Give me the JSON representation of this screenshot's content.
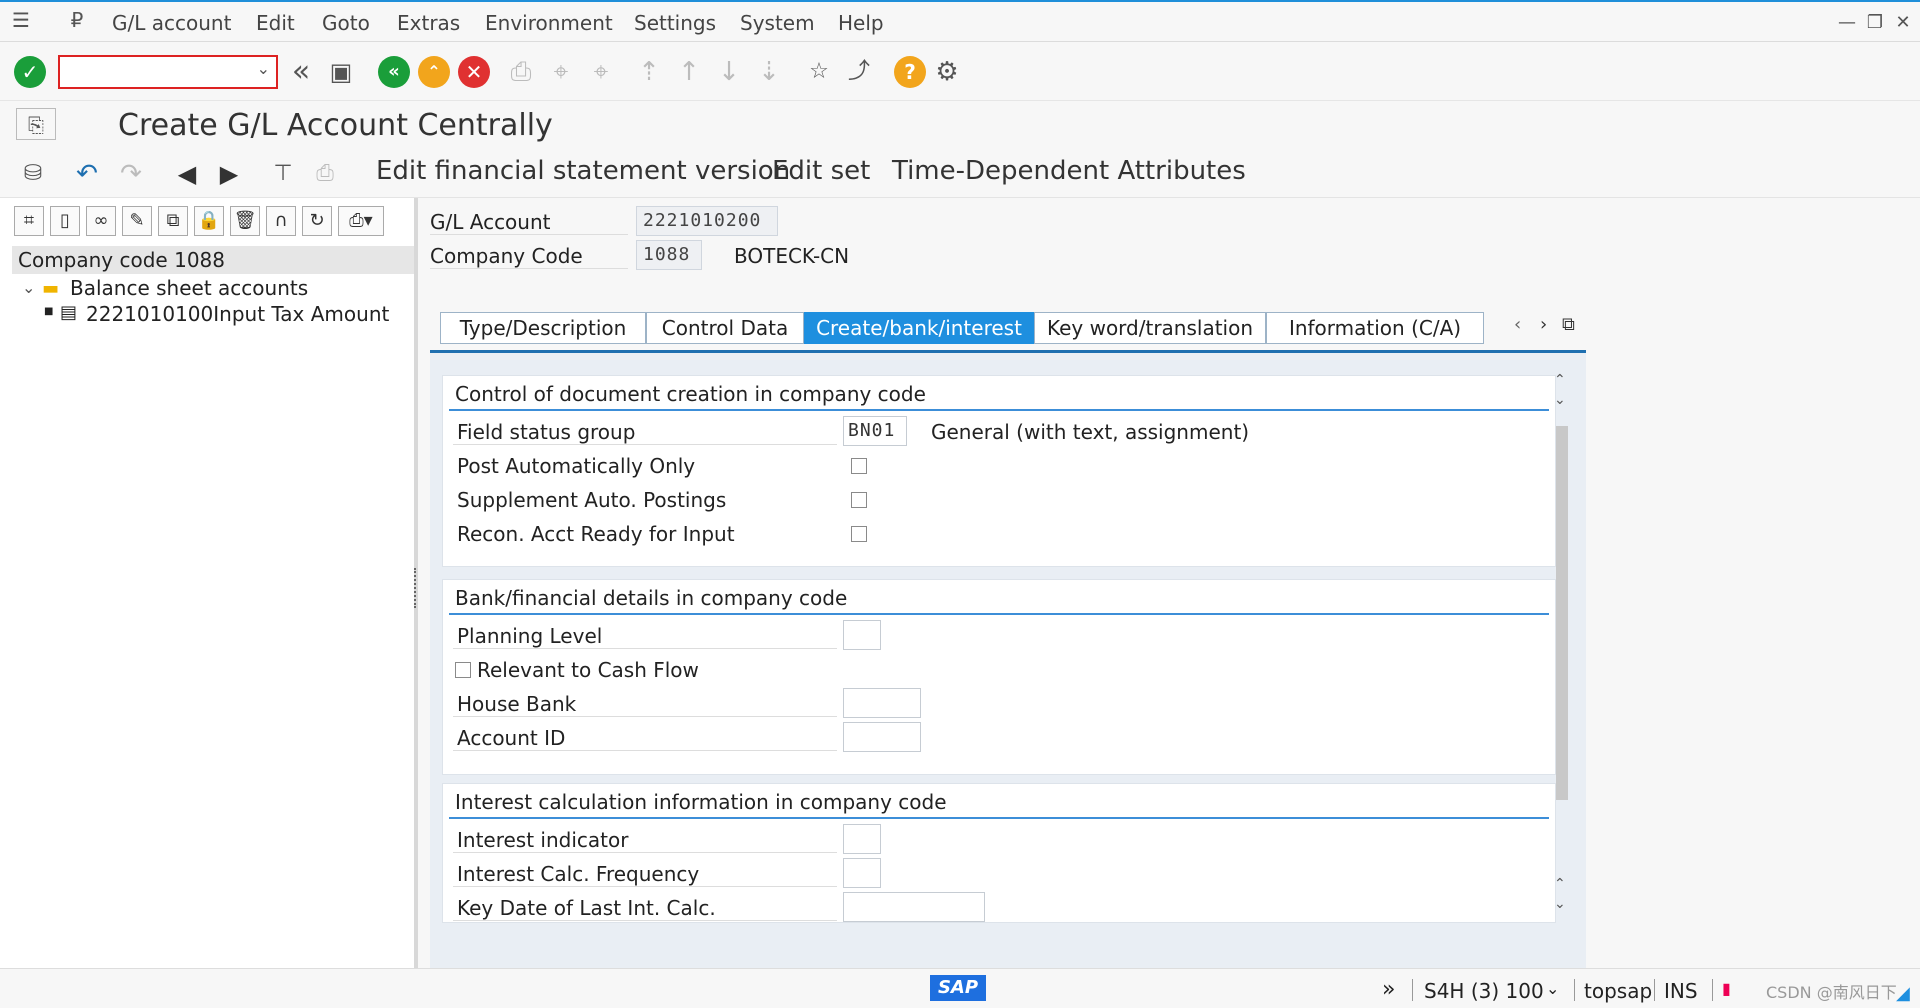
{
  "menubar": {
    "items": [
      "G/L account",
      "Edit",
      "Goto",
      "Extras",
      "Environment",
      "Settings",
      "System",
      "Help"
    ]
  },
  "toolbar": {
    "command_value": ""
  },
  "title": "Create G/L Account Centrally",
  "app_toolbar": {
    "buttons": [
      "Edit financial statement version",
      "Edit set",
      "Time-Dependent Attributes"
    ]
  },
  "tree": {
    "header": "Company code 1088",
    "folder": "Balance sheet accounts",
    "item": "2221010100Input Tax Amount"
  },
  "header": {
    "gl_account_label": "G/L Account",
    "gl_account_value": "2221010200",
    "company_code_label": "Company Code",
    "company_code_value": "1088",
    "company_name": "BOTECK-CN"
  },
  "tabs": [
    "Type/Description",
    "Control Data",
    "Create/bank/interest",
    "Key word/translation",
    "Information (C/A)"
  ],
  "active_tab": "Create/bank/interest",
  "groups": {
    "doc_creation": {
      "title": "Control of document creation in company code",
      "field_status_group_label": "Field status group",
      "field_status_group_value": "BN01",
      "field_status_group_text": "General (with text, assignment)",
      "post_auto_label": "Post Automatically Only",
      "supplement_auto_label": "Supplement Auto. Postings",
      "recon_ready_label": "Recon. Acct Ready for Input"
    },
    "bank": {
      "title": "Bank/financial details in company code",
      "planning_level_label": "Planning Level",
      "cash_flow_label": "Relevant to Cash Flow",
      "house_bank_label": "House Bank",
      "account_id_label": "Account ID"
    },
    "interest": {
      "title": "Interest calculation information in company code",
      "indicator_label": "Interest indicator",
      "frequency_label": "Interest Calc. Frequency",
      "key_date_label": "Key Date of Last Int. Calc."
    }
  },
  "statusbar": {
    "system": "S4H (3) 100",
    "host": "topsap",
    "mode": "INS",
    "watermark": "CSDN @南风日下"
  },
  "colors": {
    "accent": "#1e8fdf",
    "confirm": "#1a9e3a",
    "cancel": "#e03131",
    "exit": "#f2a51c"
  }
}
